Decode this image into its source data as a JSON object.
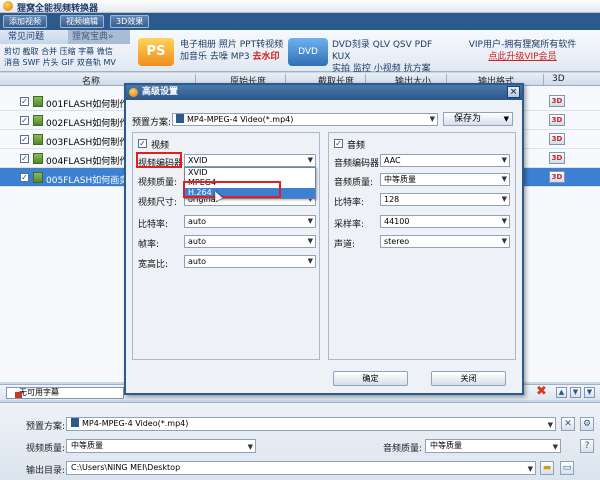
{
  "app": {
    "title": "狸窝全能视频转换器"
  },
  "toolbar": {
    "buttons": [
      "添加视频",
      "视频编辑",
      "3D效果"
    ]
  },
  "topbar": {
    "tab_active": "常见问题",
    "tab_inactive": "狸窝宝典»",
    "quicklinks_line1": "剪切 截取 合并 压缩 字幕 微信",
    "quicklinks_line2": "消音 SWF 片头 GIF 双音轨 MV",
    "promo1_icon": "PS",
    "promo1_line1": "电子相册 照片 PPT转视频",
    "promo1_line2_a": "加音乐 去噪 MP3 ",
    "promo1_line2_b": "去水印",
    "promo2_icon": "DVD",
    "promo2_line1": "DVD刻录 QLV QSV PDF KUX",
    "promo2_line2": "实拍 监控 小视频 抗方案",
    "vip_line1": "VIP用户-拥有狸窝所有软件",
    "vip_link": "点此升级VIP会员"
  },
  "columns": {
    "name": "名称",
    "c2": "原始长度",
    "c3": "截取长度",
    "c4": "输出大小",
    "c5": "输出格式",
    "c6": "3D"
  },
  "files": [
    {
      "name": "001FLASH如何制作水",
      "checked": true
    },
    {
      "name": "002FLASH如何制作打",
      "checked": true
    },
    {
      "name": "003FLASH如何制作山",
      "checked": true
    },
    {
      "name": "004FLASH如何制作卷",
      "checked": true
    },
    {
      "name": "005FLASH如何画卖运",
      "checked": true,
      "selected": true
    }
  ],
  "badge_3d": "3D",
  "subtitle": {
    "value": "无可用字幕"
  },
  "bottom": {
    "preset_label": "预置方案:",
    "preset_value": "MP4-MPEG-4 Video(*.mp4)",
    "vquality_label": "视频质量:",
    "vquality_value": "中等质量",
    "aquality_label": "音频质量:",
    "aquality_value": "中等质量",
    "output_label": "输出目录:",
    "output_value": "C:\\Users\\NING MEI\\Desktop"
  },
  "dialog": {
    "title": "高级设置",
    "close_glyph": "×",
    "preset_label": "预置方案:",
    "preset_value": "MP4-MPEG-4 Video(*.mp4)",
    "save_as": "保存为",
    "video": {
      "title": "视频",
      "checked": true,
      "encoder_label": "视频编码器:",
      "encoder_value": "XVID",
      "quality_label": "视频质量:",
      "size_label": "视频尺寸:",
      "size_value": "original",
      "bitrate_label": "比特率:",
      "bitrate_value": "auto",
      "framerate_label": "帧率:",
      "framerate_value": "auto",
      "aspect_label": "宽高比:",
      "aspect_value": "auto"
    },
    "audio": {
      "title": "音频",
      "checked": true,
      "encoder_label": "音频编码器:",
      "encoder_value": "AAC",
      "quality_label": "音频质量:",
      "quality_value": "中等质量",
      "bitrate_label": "比特率:",
      "bitrate_value": "128",
      "samplerate_label": "采样率:",
      "samplerate_value": "44100",
      "channel_label": "声道:",
      "channel_value": "stereo"
    },
    "ok": "确定",
    "close": "关闭",
    "encoder_options": [
      "XVID",
      "MPEG4",
      "H.264"
    ],
    "encoder_highlighted": "H.264"
  },
  "colors": {
    "accent": "#2d5a8c",
    "selection": "#3d7fd0",
    "highlight": "#e02020"
  }
}
